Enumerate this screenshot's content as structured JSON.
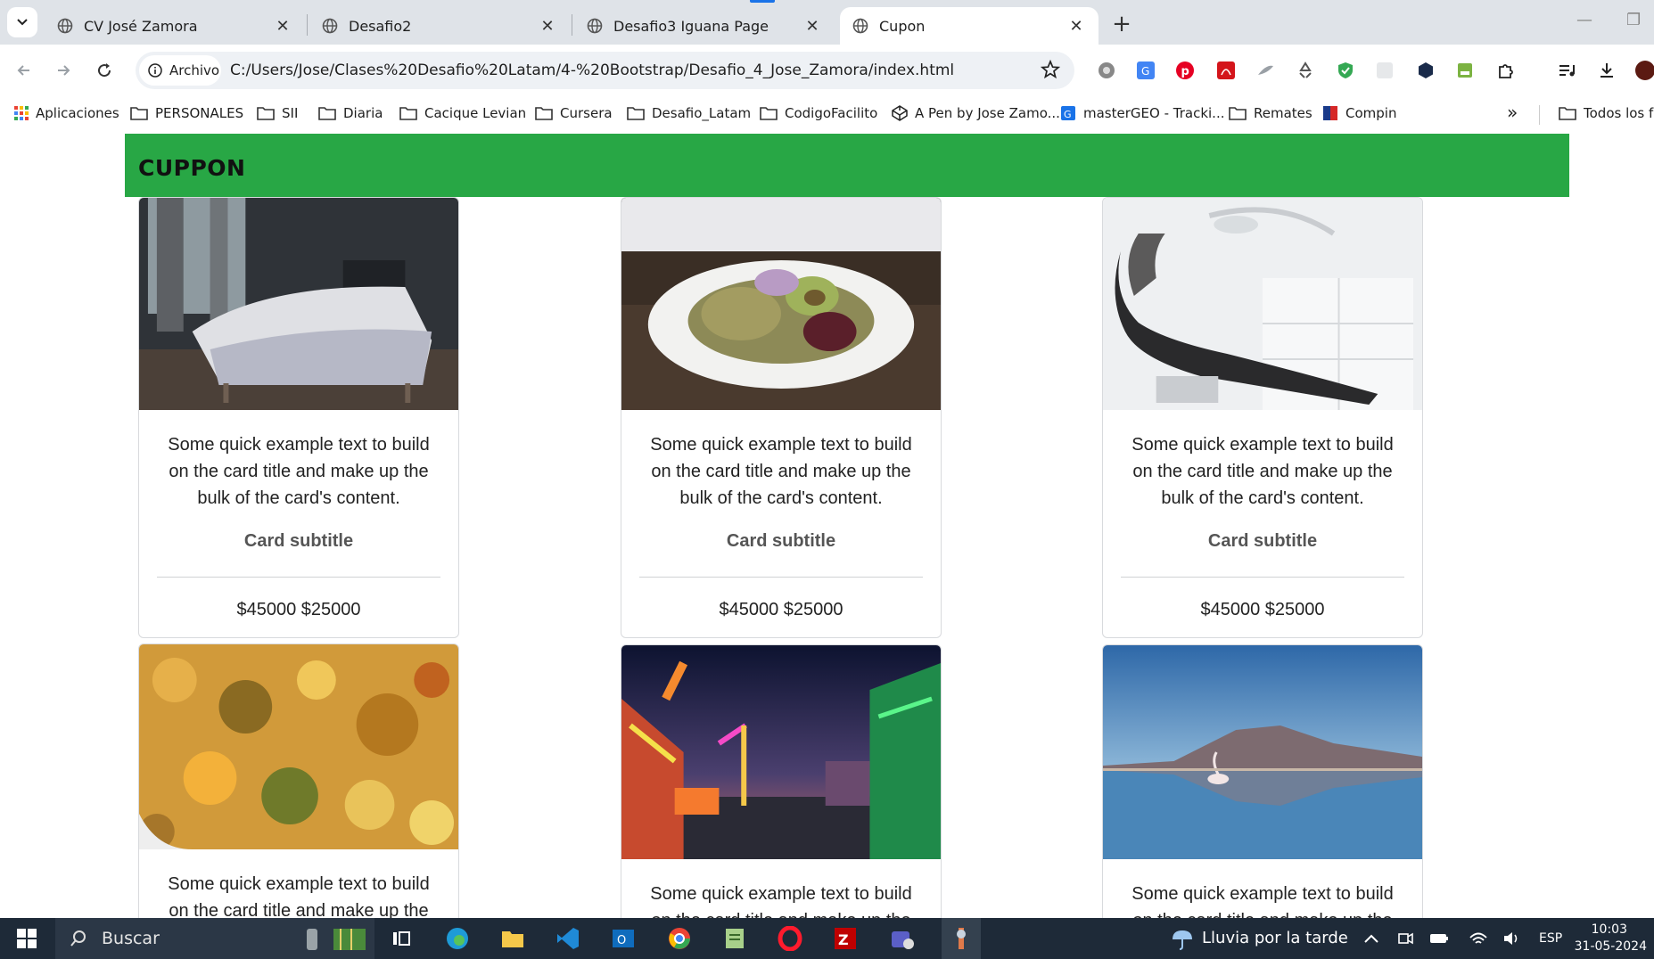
{
  "browser": {
    "tabs": [
      {
        "title": "CV José Zamora",
        "active": false
      },
      {
        "title": "Desafio2",
        "active": false
      },
      {
        "title": "Desafio3 Iguana Page",
        "active": false
      },
      {
        "title": "Cupon",
        "active": true
      }
    ],
    "site_chip": "Archivo",
    "url": "C:/Users/Jose/Clases%20Desafio%20Latam/4-%20Bootstrap/Desafio_4_Jose_Zamora/index.html",
    "bookmarks": [
      {
        "label": "Aplicaciones",
        "icon": "apps-grid-icon"
      },
      {
        "label": "PERSONALES",
        "icon": "folder-icon"
      },
      {
        "label": "SII",
        "icon": "folder-icon"
      },
      {
        "label": "Diaria",
        "icon": "folder-icon"
      },
      {
        "label": "Cacique Levian",
        "icon": "folder-icon"
      },
      {
        "label": "Cursera",
        "icon": "folder-icon"
      },
      {
        "label": "Desafio_Latam",
        "icon": "folder-icon"
      },
      {
        "label": "CodigoFacilito",
        "icon": "folder-icon"
      },
      {
        "label": "A Pen by Jose Zamo...",
        "icon": "codepen-icon"
      },
      {
        "label": "masterGEO - Tracki...",
        "icon": "mastergeo-icon"
      },
      {
        "label": "Remates",
        "icon": "folder-icon"
      },
      {
        "label": "Compin",
        "icon": "compin-icon"
      }
    ],
    "bookmarks_more": "»",
    "bookmarks_all": "Todos los fa"
  },
  "page": {
    "brand": "CUPPON",
    "cards": [
      {
        "image": "bedroom-photo",
        "text": "Some quick example text to build on the card title and make up the bulk of the card's content.",
        "subtitle": "Card subtitle",
        "price": "$45000 $25000"
      },
      {
        "image": "salad-photo",
        "text": "Some quick example text to build on the card title and make up the bulk of the card's content.",
        "subtitle": "Card subtitle",
        "price": "$45000 $25000"
      },
      {
        "image": "dental-chair-photo",
        "text": "Some quick example text to build on the card title and make up the bulk of the card's content.",
        "subtitle": "Card subtitle",
        "price": "$45000 $25000"
      },
      {
        "image": "food-closeup-photo",
        "text": "Some quick example text to build on the card title and make up the",
        "subtitle": "",
        "price": ""
      },
      {
        "image": "fair-night-photo",
        "text": "Some quick example text to build on the card title and make up the",
        "subtitle": "",
        "price": ""
      },
      {
        "image": "flamingo-lake-photo",
        "text": "Some quick example text to build on the card title and make up the",
        "subtitle": "",
        "price": ""
      }
    ]
  },
  "taskbar": {
    "search_placeholder": "Buscar",
    "weather": "Lluvia por la tarde",
    "language": "ESP",
    "time": "10:03",
    "date": "31-05-2024"
  },
  "colors": {
    "brand_bar": "#28a745",
    "tabbar": "#dfe3e8",
    "taskbar": "#1e2a38"
  }
}
